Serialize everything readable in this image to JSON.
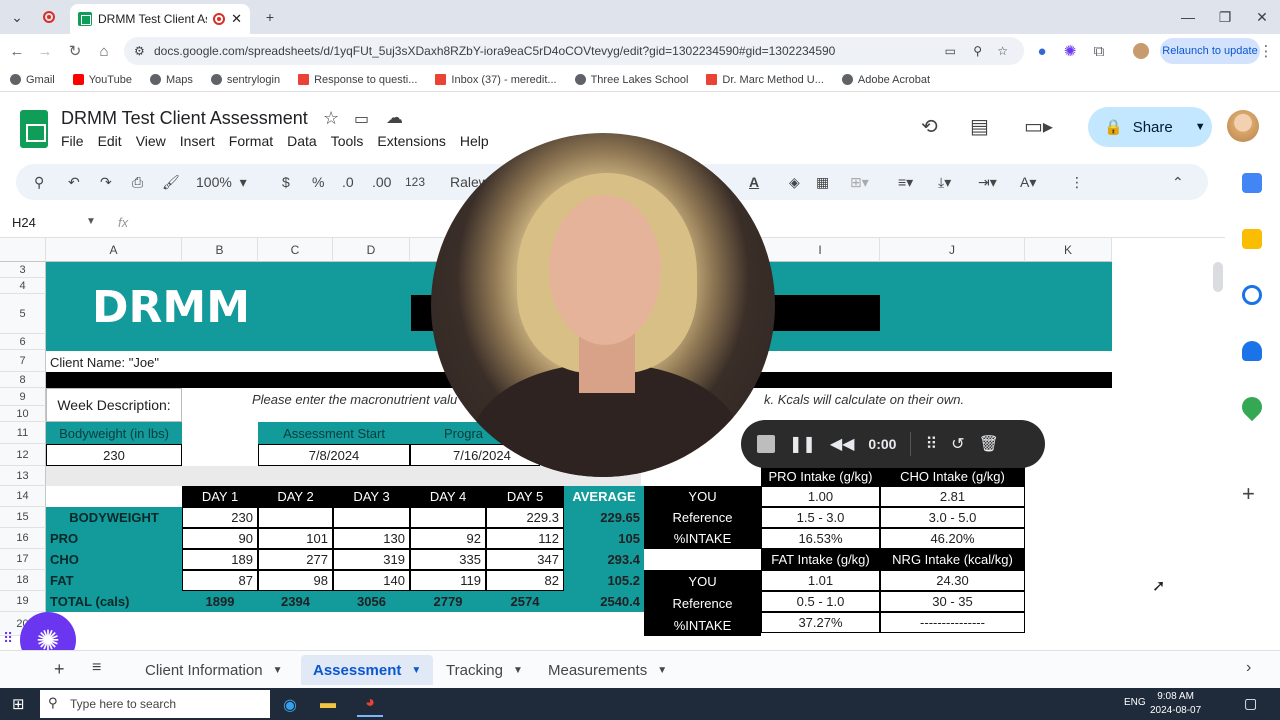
{
  "browser": {
    "tab_title": "DRMM Test Client Assessm",
    "url": "docs.google.com/spreadsheets/d/1yqFUt_5uj3sXDaxh8RZbY-iora9eaC5rD4oCOVtevyg/edit?gid=1302234590#gid=1302234590",
    "relaunch_label": "Relaunch to update",
    "bookmarks": [
      "Gmail",
      "YouTube",
      "Maps",
      "sentrylogin",
      "Response to questi...",
      "Inbox (37) - meredit...",
      "Three Lakes School",
      "Dr. Marc Method U...",
      "Adobe Acrobat"
    ]
  },
  "sheets": {
    "title": "DRMM Test Client Assessment",
    "menu": [
      "File",
      "Edit",
      "View",
      "Insert",
      "Format",
      "Data",
      "Tools",
      "Extensions",
      "Help"
    ],
    "share_label": "Share",
    "zoom": "100%",
    "currency": "$",
    "percent": "%",
    "dec_less": ".0",
    "dec_more": ".00",
    "number_format": "123",
    "font_partial": "Ralew",
    "name_box": "H24",
    "fx": "fx",
    "columns": [
      "A",
      "B",
      "C",
      "D",
      "I",
      "J",
      "K"
    ],
    "rows": [
      "3",
      "4",
      "5",
      "6",
      "7",
      "8",
      "9",
      "10",
      "11",
      "12",
      "13",
      "14",
      "15",
      "16",
      "17",
      "18",
      "19",
      "20"
    ]
  },
  "content": {
    "brand": "DRMM",
    "client_name": "Client Name: \"Joe\"",
    "week_description": "Week Description:",
    "instructions": "Please enter the macronutrient valu",
    "instructions_tail": "k. Kcals will calculate on their own.",
    "bodyweight_label": "Bodyweight (in lbs)",
    "bodyweight_value": "230",
    "assessment_start_label": "Assessment Start",
    "assessment_start_value": "7/8/2024",
    "program_label": "Progra",
    "program_value": "7/16/2024",
    "days_header": [
      "DAY 1",
      "DAY 2",
      "DAY 3",
      "DAY 4",
      "DAY 5",
      "AVERAGE"
    ],
    "table_rows": [
      {
        "label": "BODYWEIGHT",
        "values": [
          "230",
          "",
          "",
          "",
          "229.3"
        ],
        "avg": "229.65"
      },
      {
        "label": "PRO",
        "values": [
          "90",
          "101",
          "130",
          "92",
          "112"
        ],
        "avg": "105"
      },
      {
        "label": "CHO",
        "values": [
          "189",
          "277",
          "319",
          "335",
          "347"
        ],
        "avg": "293.4"
      },
      {
        "label": "FAT",
        "values": [
          "87",
          "98",
          "140",
          "119",
          "82"
        ],
        "avg": "105.2"
      },
      {
        "label": "TOTAL (cals)",
        "values": [
          "1899",
          "2394",
          "3056",
          "2779",
          "2574"
        ],
        "avg": "2540.4"
      }
    ],
    "intake": {
      "pro_header": "PRO Intake (g/kg)",
      "cho_header": "CHO Intake (g/kg)",
      "you": "YOU",
      "reference": "Reference",
      "pct_intake": "%INTAKE",
      "pro_you": "1.00",
      "cho_you": "2.81",
      "pro_ref": "1.5 - 3.0",
      "cho_ref": "3.0 - 5.0",
      "pro_pct": "16.53%",
      "cho_pct": "46.20%",
      "fat_header": "FAT Intake (g/kg)",
      "nrg_header": "NRG Intake (kcal/kg)",
      "fat_you": "1.01",
      "nrg_you": "24.30",
      "fat_ref": "0.5 - 1.0",
      "nrg_ref": "30 - 35",
      "fat_pct": "37.27%",
      "nrg_pct": "---------------"
    }
  },
  "sheet_tabs": [
    "Client Information",
    "Assessment",
    "Tracking",
    "Measurements"
  ],
  "recorder": {
    "timer": "0:00"
  },
  "taskbar": {
    "search_placeholder": "Type here to search",
    "lang": "ENG",
    "time": "9:08 AM",
    "date": "2024-08-07"
  }
}
